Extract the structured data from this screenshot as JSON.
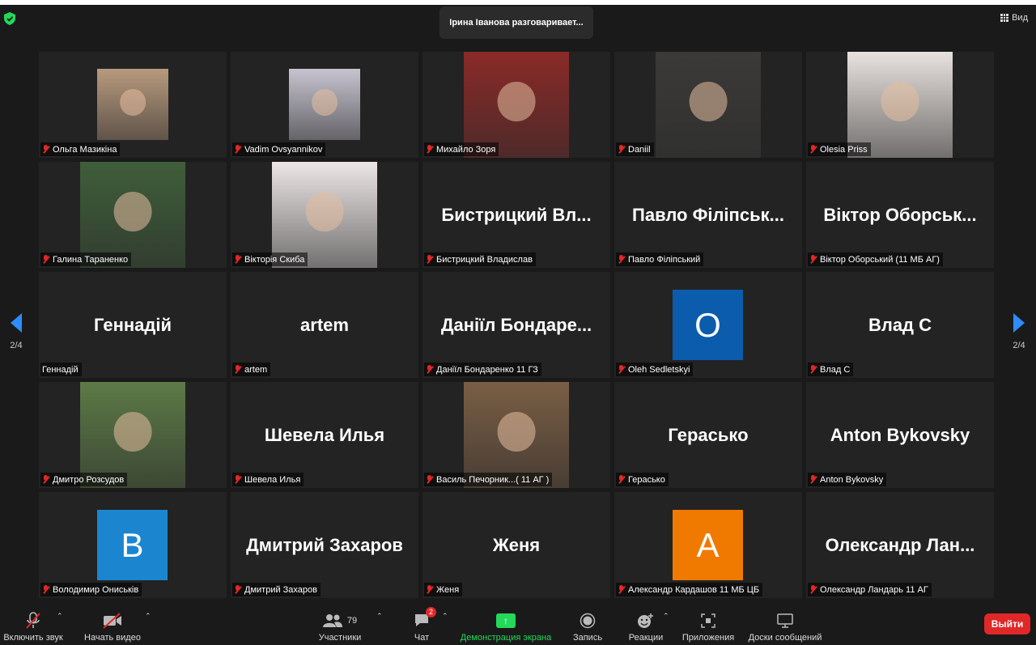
{
  "header": {
    "speaker_banner": "Ірина Іванова разговаривает...",
    "view_label": "Вид"
  },
  "pager": {
    "left": "2/4",
    "right": "2/4"
  },
  "participants": [
    {
      "name": "Ольга Мазикіна",
      "display": "photo",
      "muted": true
    },
    {
      "name": "Vadim Ovsyannikov",
      "display": "photo",
      "muted": true
    },
    {
      "name": "Михайло Зоря",
      "display": "photo",
      "muted": true
    },
    {
      "name": "Daniil",
      "display": "photo",
      "muted": true
    },
    {
      "name": "Olesia Priss",
      "display": "photo",
      "muted": true
    },
    {
      "name": "Галина Тараненко",
      "display": "photo",
      "muted": true
    },
    {
      "name": "Вікторія Скиба",
      "display": "photo",
      "muted": true
    },
    {
      "name": "Бистрицкий Владислав",
      "big": "Бистрицкий Вл...",
      "display": "name",
      "muted": true
    },
    {
      "name": "Павло Філіпський",
      "big": "Павло Філіпськ...",
      "display": "name",
      "muted": true
    },
    {
      "name": "Віктор Оборський (11 МБ АГ)",
      "big": "Віктор Оборськ...",
      "display": "name",
      "muted": true
    },
    {
      "name": "Геннадій",
      "big": "Геннадій",
      "display": "name",
      "muted": false
    },
    {
      "name": "artem",
      "big": "artem",
      "display": "name",
      "muted": true
    },
    {
      "name": "Даніїл Бондаренко 11 ГЗ",
      "big": "Даніїл Бондаре...",
      "display": "name",
      "muted": true
    },
    {
      "name": "Oleh Sedletskyi",
      "avatar": "O",
      "avatar_color": "#0b5cad",
      "display": "avatar",
      "muted": true
    },
    {
      "name": "Влад С",
      "big": "Влад С",
      "display": "name",
      "muted": true
    },
    {
      "name": "Дмитро Розсудов",
      "display": "photo",
      "muted": true
    },
    {
      "name": "Шевела Илья",
      "big": "Шевела Илья",
      "display": "name",
      "muted": true
    },
    {
      "name": "Василь Печорник...( 11 АГ )",
      "display": "photo",
      "muted": true
    },
    {
      "name": "Герасько",
      "big": "Герасько",
      "display": "name",
      "muted": true
    },
    {
      "name": "Anton Bykovsky",
      "big": "Anton Bykovsky",
      "display": "name",
      "muted": true
    },
    {
      "name": "Володимир Ониськів",
      "avatar": "B",
      "avatar_color": "#1b86cf",
      "display": "avatar",
      "muted": true
    },
    {
      "name": "Дмитрий Захаров",
      "big": "Дмитрий Захаров",
      "display": "name",
      "muted": true
    },
    {
      "name": "Женя",
      "big": "Женя",
      "display": "name",
      "muted": true
    },
    {
      "name": "Александр Кардашов 11 МБ ЦБ",
      "avatar": "A",
      "avatar_color": "#f07a00",
      "display": "avatar",
      "muted": true
    },
    {
      "name": "Олександр Ландарь 11 АГ",
      "big": "Олександр Лан...",
      "display": "name",
      "muted": true
    }
  ],
  "toolbar": {
    "unmute": "Включить звук",
    "start_video": "Начать видео",
    "participants": "Участники",
    "participants_count": "79",
    "chat": "Чат",
    "chat_badge": "2",
    "share": "Демонстрация экрана",
    "record": "Запись",
    "reactions": "Реакции",
    "apps": "Приложения",
    "whiteboards": "Доски сообщений",
    "leave": "Выйти"
  },
  "colors": {
    "accent": "#2d8cff",
    "share": "#23d959",
    "leave": "#e02828"
  }
}
